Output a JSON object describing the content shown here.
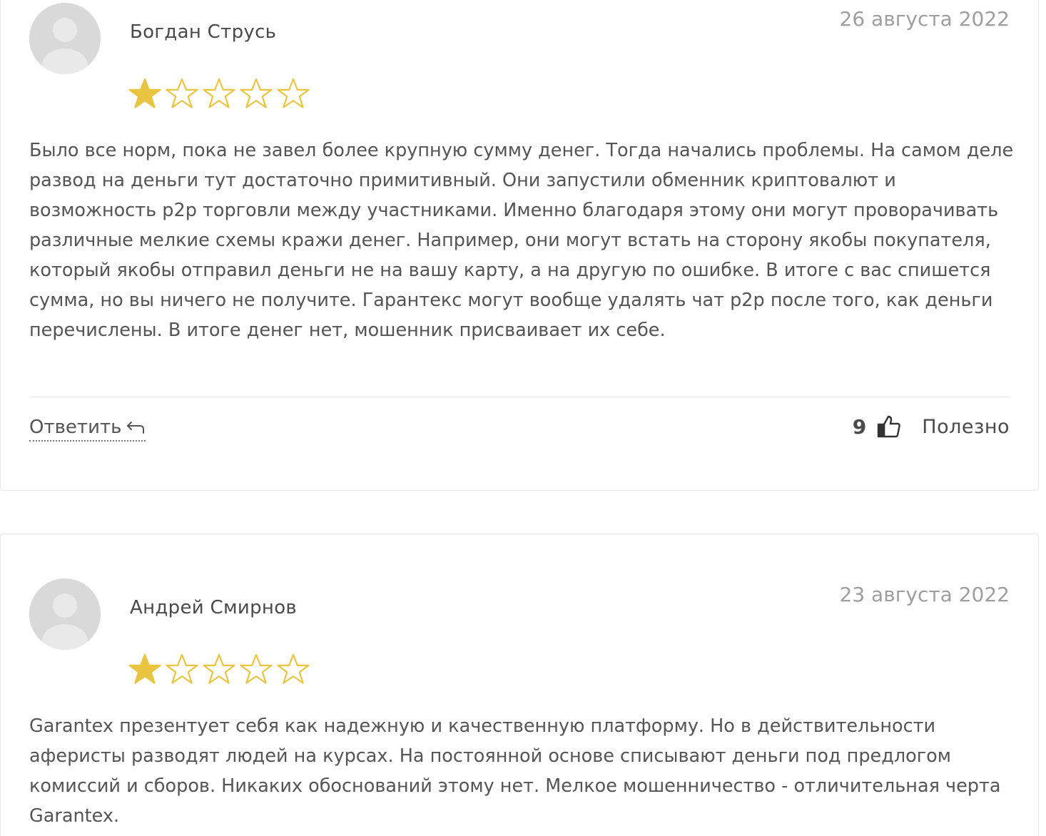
{
  "colors": {
    "star_fill": "#E8C441",
    "star_outline": "#E8C441",
    "text": "#555555",
    "date": "#9E9E9E",
    "avatar_bg": "#D9D9D9"
  },
  "reviews": [
    {
      "author": "Богдан Струсь",
      "date": "26 августа 2022",
      "rating": 1,
      "rating_max": 5,
      "text": "Было все норм, пока не завел более крупную сумму денег. Тогда начались проблемы. На самом деле развод на деньги тут достаточно примитивный. Они запустили обменник криптовалют и возможность p2p торговли между участниками. Именно благодаря этому они могут проворачивать различные мелкие схемы кражи денег. Например, они могут встать на сторону якобы покупателя, который якобы отправил деньги не на вашу карту, а на другую по ошибке. В итоге с вас спишется сумма, но вы ничего не получите. Гарантекс могут вообще удалять чат p2p после того, как деньги перечислены. В итоге денег нет, мошенник присваивает их себе.",
      "reply_label": "Ответить",
      "useful_count": "9",
      "useful_label": "Полезно"
    },
    {
      "author": "Андрей Смирнов",
      "date": "23 августа 2022",
      "rating": 1,
      "rating_max": 5,
      "text": "Garantex презентует себя как надежную и качественную платформу. Но в действительности аферисты разводят людей на курсах. На постоянной основе списывают деньги под предлогом комиссий и сборов. Никаких обоснований этому нет. Мелкое мошенничество - отличительная черта Garantex."
    }
  ]
}
